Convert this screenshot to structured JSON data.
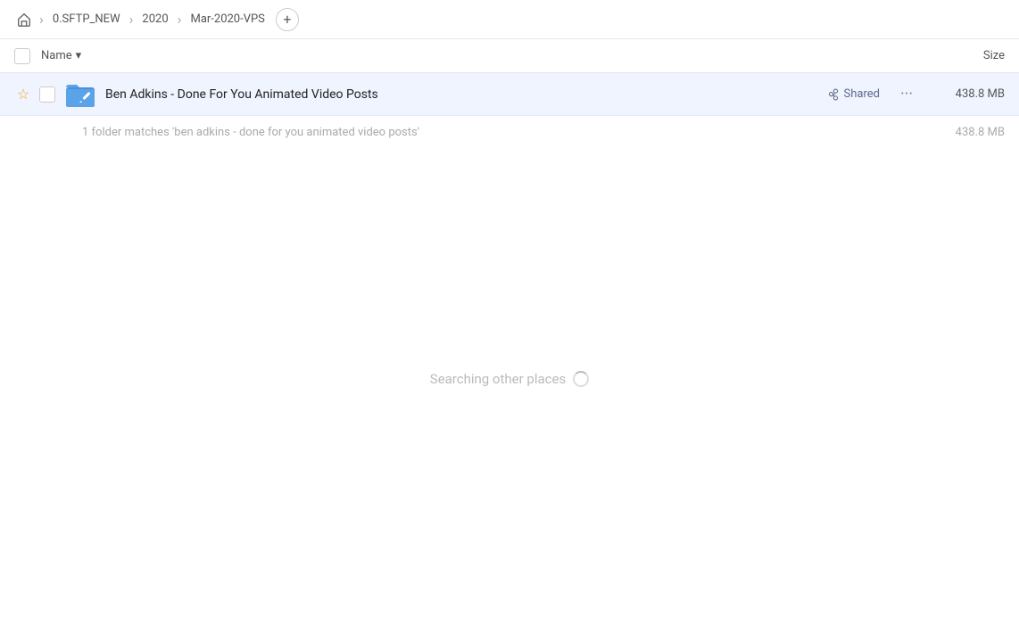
{
  "breadcrumb": {
    "home_icon": "🏠",
    "items": [
      {
        "label": "0.SFTP_NEW"
      },
      {
        "label": "2020"
      },
      {
        "label": "Mar-2020-VPS"
      }
    ],
    "add_label": "+"
  },
  "column_header": {
    "name_label": "Name",
    "sort_icon": "▾",
    "size_label": "Size"
  },
  "file_row": {
    "name": "Ben Adkins - Done For You Animated Video Posts",
    "shared_label": "Shared",
    "size": "438.8 MB"
  },
  "summary": {
    "text": "1 folder matches 'ben adkins - done for you animated video posts'",
    "size": "438.8 MB"
  },
  "searching": {
    "text": "Searching other places"
  }
}
